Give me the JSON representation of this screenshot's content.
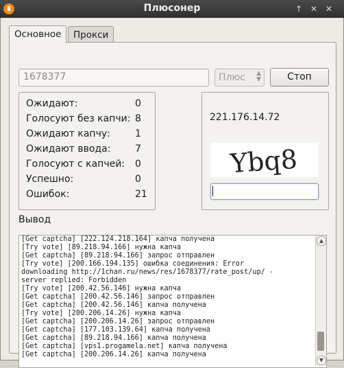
{
  "window": {
    "title": "Плюсонер",
    "controls": [
      "↑",
      "✕",
      "✕"
    ]
  },
  "tabs": [
    {
      "label": "Основное",
      "active": true
    },
    {
      "label": "Прокси",
      "active": false
    }
  ],
  "controls": {
    "thread_value": "1678377",
    "mode_selected": "Плюс",
    "stop_label": "Стоп"
  },
  "stats": [
    {
      "label": "Ожидают:",
      "value": "0"
    },
    {
      "label": "Голосуют без капчи:",
      "value": "8"
    },
    {
      "label": "Ожидают капчу:",
      "value": "1"
    },
    {
      "label": "Ожидают ввода:",
      "value": "7"
    },
    {
      "label": "Голосуют с капчей:",
      "value": "0"
    },
    {
      "label": "Успешно:",
      "value": "0"
    },
    {
      "label": "Ошибок:",
      "value": "21"
    }
  ],
  "captcha": {
    "ip": "221.176.14.72",
    "image_text": "Ybq8",
    "input_value": ""
  },
  "output": {
    "label": "Вывод",
    "lines": [
      "[Get captcha] [222.124.218.164] капча получена",
      "[Try vote] [89.218.94.166] нужна капча",
      "[Get captcha] [89.218.94.166] запрос отправлен",
      "[Try vote] [200.166.194.135] ошибка соединения: Error",
      "downloading http://1chan.ru/news/res/1678377/rate_post/up/ -",
      "server replied: Forbidden",
      "[Try vote] [200.42.56.146] нужна капча",
      "[Get captcha] [200.42.56.146] запрос отправлен",
      "[Get captcha] [200.42.56.146] капча получена",
      "[Try vote] [200.206.14.26] нужна капча",
      "[Get captcha] [200.206.14.26] запрос отправлен",
      "[Get captcha] [177.103.139.64] капча получена",
      "[Get captcha] [89.218.94.166] капча получена",
      "[Get captcha] [vps1.progamela.net] капча получена",
      "[Get captcha] [200.206.14.26] капча получена"
    ]
  }
}
